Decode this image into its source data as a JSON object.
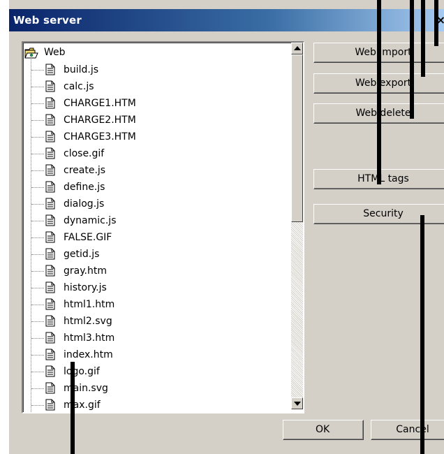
{
  "window": {
    "title": "Web server",
    "close_glyph": "×"
  },
  "tree": {
    "root_label": "Web",
    "root_icon": "open-folder-icon",
    "file_icon": "document-icon",
    "items": [
      "build.js",
      "calc.js",
      "CHARGE1.HTM",
      "CHARGE2.HTM",
      "CHARGE3.HTM",
      "close.gif",
      "create.js",
      "define.js",
      "dialog.js",
      "dynamic.js",
      "FALSE.GIF",
      "getid.js",
      "gray.htm",
      "history.js",
      "html1.htm",
      "html2.svg",
      "html3.htm",
      "index.htm",
      "logo.gif",
      "main.svg",
      "max.gif"
    ]
  },
  "buttons": {
    "web_import": "Web import",
    "web_export": "Web export",
    "web_delete": "Web delete",
    "html_tags": "HTML tags",
    "security": "Security",
    "ok": "OK",
    "cancel": "Cancel"
  },
  "colors": {
    "face": "#d4d0c8",
    "title_start": "#0a246a",
    "title_end": "#a6caf0"
  }
}
